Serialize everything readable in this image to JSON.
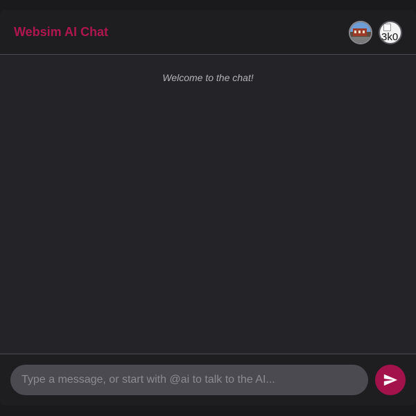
{
  "header": {
    "title": "Websim AI Chat",
    "avatars": [
      {
        "name": "user-avatar-photo"
      },
      {
        "name": "user-avatar-broken",
        "alt_text": "3k0"
      }
    ]
  },
  "messages": {
    "welcome": "Welcome to the chat!"
  },
  "composer": {
    "placeholder": "Type a message, or start with @ai to talk to the AI...",
    "value": "",
    "send_icon": "send-icon"
  },
  "colors": {
    "accent": "#b0164e",
    "send_button": "#a3124a",
    "background": "#242428",
    "header": "#1e1e21",
    "input": "#4a4a50"
  }
}
